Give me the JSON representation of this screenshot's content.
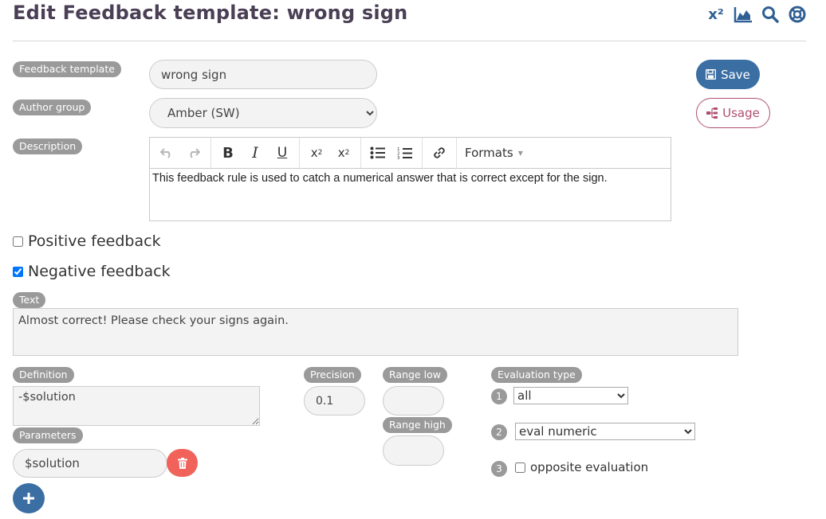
{
  "header": {
    "title": "Edit Feedback template: wrong sign",
    "superscript_label": "x²"
  },
  "labels": {
    "feedback_template": "Feedback template",
    "author_group": "Author group",
    "description": "Description",
    "text": "Text",
    "definition": "Definition",
    "parameters": "Parameters",
    "precision": "Precision",
    "range_low": "Range low",
    "range_high": "Range high",
    "evaluation_type": "Evaluation type"
  },
  "fields": {
    "feedback_template_value": "wrong sign",
    "author_group_selected": "Amber (SW)",
    "description_text": "This feedback rule is used to catch a numerical answer that is correct except for the sign.",
    "text_value": "Almost correct! Please check your signs again.",
    "definition_value": "-$solution",
    "parameter_value": "$solution",
    "precision_value": "0.1",
    "range_low_value": "",
    "range_high_value": ""
  },
  "buttons": {
    "save": "Save",
    "usage": "Usage"
  },
  "editor": {
    "formats_label": "Formats"
  },
  "checkboxes": {
    "positive_label": "Positive feedback",
    "positive_checked": false,
    "negative_label": "Negative feedback",
    "negative_checked": true,
    "opposite_label": "opposite evaluation",
    "opposite_checked": false
  },
  "evaluation": {
    "step1_number": "1",
    "step1_selected": "all",
    "step2_number": "2",
    "step2_selected": "eval numeric",
    "step3_number": "3"
  },
  "colors": {
    "primary": "#3b6fa3",
    "usage": "#b05070",
    "delete": "#f0625a",
    "label_bg": "#9a9a9a",
    "title": "#4a3f55"
  }
}
